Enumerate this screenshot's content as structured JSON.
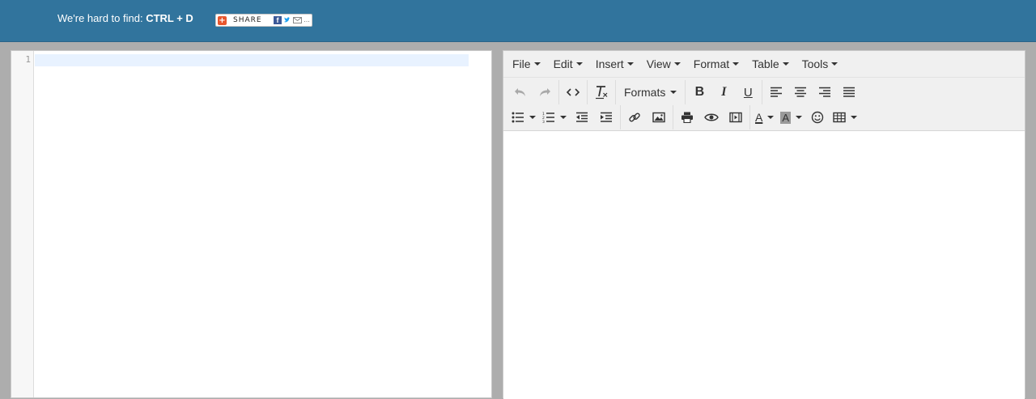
{
  "banner": {
    "tagline_prefix": "We're hard to find: ",
    "tagline_hotkey": "CTRL + D",
    "share_label": "SHARE",
    "share_fb_glyph": "f",
    "share_tw_glyph": "t",
    "share_more_glyph": "…",
    "background_color": "#31749d"
  },
  "code_editor": {
    "line_numbers": [
      "1"
    ]
  },
  "rich_editor": {
    "menu": [
      {
        "label": "File"
      },
      {
        "label": "Edit"
      },
      {
        "label": "Insert"
      },
      {
        "label": "View"
      },
      {
        "label": "Format"
      },
      {
        "label": "Table"
      },
      {
        "label": "Tools"
      }
    ],
    "formats_label": "Formats",
    "toolbar_icons": {
      "undo": "undo-icon",
      "redo": "redo-icon",
      "source_code": "source-code-icon",
      "clear_formatting": "clear-formatting-icon",
      "bold": "bold-icon",
      "italic": "italic-icon",
      "underline": "underline-icon",
      "align_left": "align-left-icon",
      "align_center": "align-center-icon",
      "align_right": "align-right-icon",
      "align_justify": "align-justify-icon",
      "bullet_list": "bullet-list-icon",
      "numbered_list": "numbered-list-icon",
      "outdent": "outdent-icon",
      "indent": "indent-icon",
      "link": "link-icon",
      "image": "image-icon",
      "print": "print-icon",
      "preview": "preview-icon",
      "media": "media-icon",
      "text_color": "text-color-icon",
      "background_color": "background-color-icon",
      "emoticons": "emoticons-icon",
      "table": "table-icon"
    },
    "bold_glyph": "B",
    "italic_glyph": "I",
    "underline_glyph": "U",
    "text_color_glyph": "A",
    "background_color_glyph": "A"
  }
}
